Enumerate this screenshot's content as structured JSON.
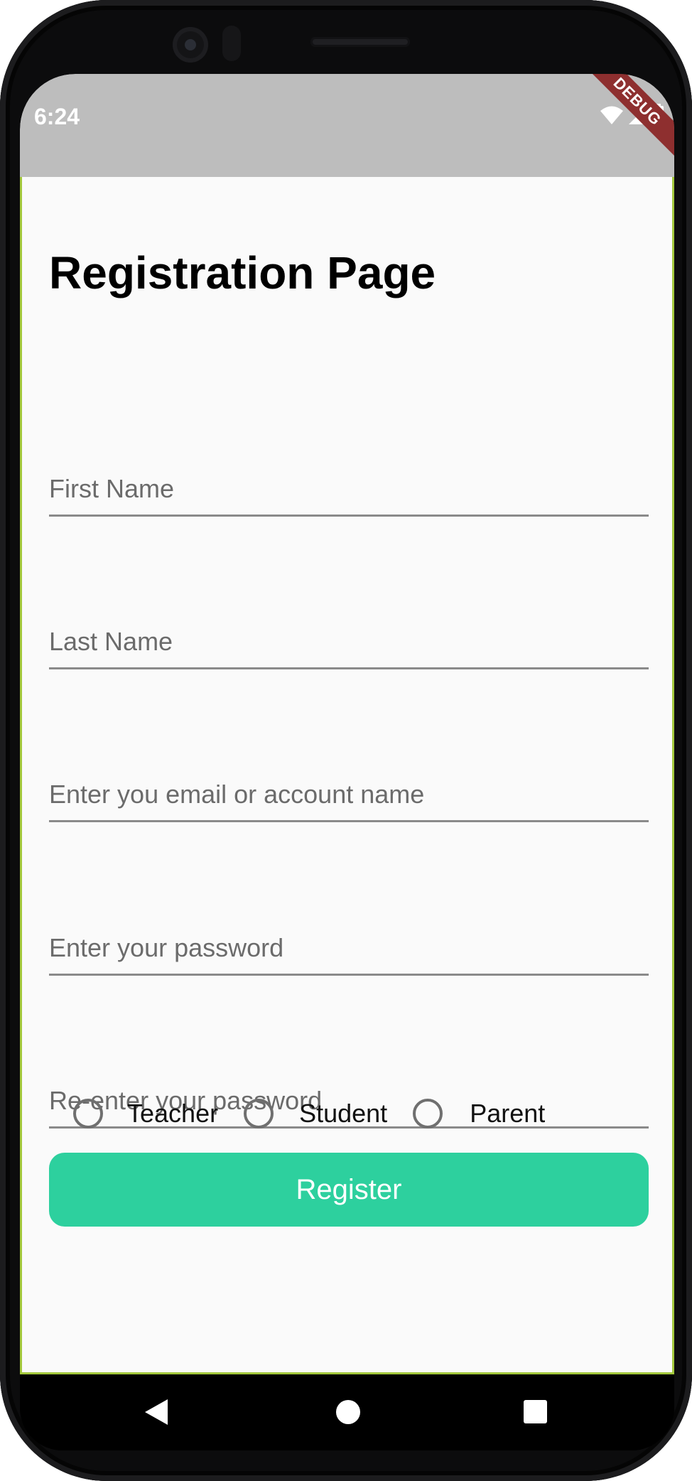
{
  "status_bar": {
    "time": "6:24",
    "debug_banner": "DEBUG",
    "icons": [
      "wifi-icon",
      "signal-icon",
      "battery-icon"
    ]
  },
  "page": {
    "title": "Registration Page"
  },
  "form": {
    "first_name_placeholder": "First Name",
    "last_name_placeholder": "Last Name",
    "email_placeholder": "Enter you email or account name",
    "password_placeholder": "Enter your password",
    "confirm_password_placeholder": "Re-enter your password",
    "roles": [
      {
        "label": "Teacher",
        "selected": false
      },
      {
        "label": "Student",
        "selected": false
      },
      {
        "label": "Parent",
        "selected": false
      }
    ],
    "register_label": "Register"
  },
  "nav_bar": {
    "buttons": [
      "back-icon",
      "home-icon",
      "recents-icon"
    ]
  },
  "colors": {
    "accent": "#2dd09e",
    "status_bar": "#bdbdbd",
    "debug_banner": "#8e2f2f",
    "background": "#fafafa"
  }
}
